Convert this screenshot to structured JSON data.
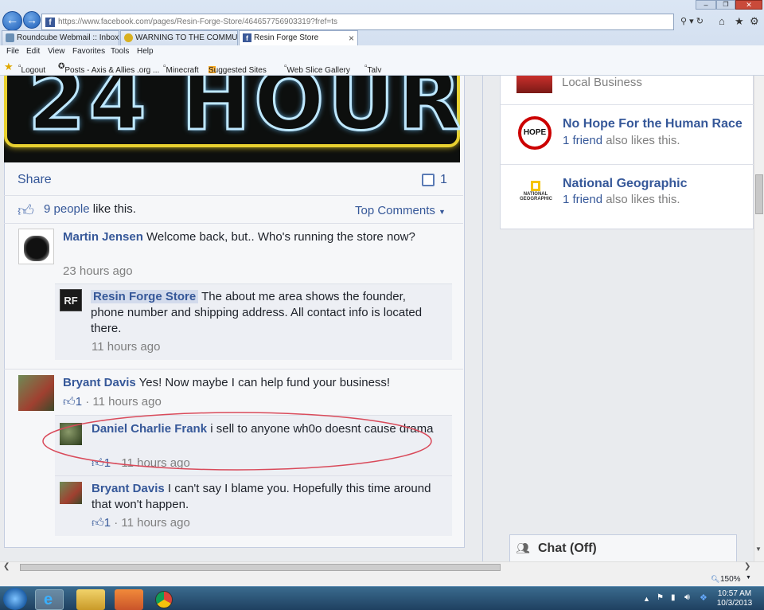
{
  "browser": {
    "address_url": "https://www.facebook.com/pages/Resin-Forge-Store/464657756903319?fref=ts",
    "search_glyph": "⚲ ▾ ↻",
    "window_controls": [
      "–",
      "❐",
      "✕"
    ],
    "tabs": [
      {
        "label": "Roundcube Webmail :: Inbox"
      },
      {
        "label": "WARNING TO THE COMMUNI..."
      },
      {
        "label": "Resin Forge Store"
      }
    ],
    "tab_close": "×",
    "menu": [
      "File",
      "Edit",
      "View",
      "Favorites",
      "Tools",
      "Help"
    ],
    "favorites": [
      "Logout",
      "Posts - Axis & Allies .org ...",
      "Minecraft",
      "Suggested Sites",
      "Web Slice Gallery",
      "Talv"
    ]
  },
  "post": {
    "photo_text": "24 HOURS",
    "share_label": "Share",
    "comment_count": "1",
    "likes_count_link": "9 people",
    "likes_suffix": "like this.",
    "sort_label": "Top Comments"
  },
  "comments": [
    {
      "author": "Martin Jensen",
      "text": "Welcome back, but.. Who's running the store now?",
      "time": "23 hours ago",
      "replies": [
        {
          "author": "Resin Forge Store",
          "avatar_text": "RF",
          "text": "The about me area shows the founder, phone number and shipping address. All contact info is located there.",
          "time": "11 hours ago"
        }
      ]
    },
    {
      "author": "Bryant Davis",
      "text": "Yes! Now maybe I can help fund your business!",
      "likes": "1",
      "time": "11 hours ago",
      "replies": [
        {
          "author": "Daniel Charlie Frank",
          "text": "i sell to anyone wh0o doesnt cause drama",
          "likes": "1",
          "time": "11 hours ago"
        },
        {
          "author": "Bryant Davis",
          "text": "I can't say I blame you. Hopefully this time around that won't happen.",
          "likes": "1",
          "time": "11 hours ago"
        }
      ]
    }
  ],
  "sidebar": {
    "top_item": "Local Business",
    "pages": [
      {
        "name": "No Hope For the Human Race",
        "avatar_text": "HOPE",
        "friends_link": "1 friend",
        "suffix": "also likes this."
      },
      {
        "name": "National Geographic",
        "avatar_text": "NATIONAL GEOGRAPHIC",
        "friends_link": "1 friend",
        "suffix": "also likes this."
      }
    ]
  },
  "chat": {
    "label": "Chat (Off)"
  },
  "status": {
    "zoom": "150%"
  },
  "taskbar": {
    "time": "10:57 AM",
    "date": "10/3/2013"
  },
  "colors": {
    "facebook_link": "#365899",
    "highlight_circle": "#d94a5a"
  }
}
